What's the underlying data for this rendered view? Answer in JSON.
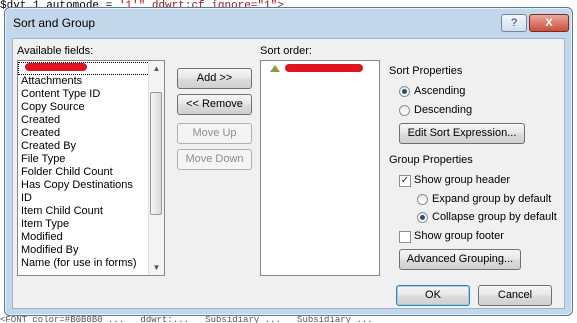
{
  "background_code": {
    "top_line_parts": [
      "$dvt_1_automode = ",
      "'1'",
      "\" ddwrt:cf_ignore=\"1\">"
    ],
    "bottom_line": "<FONT color=#B0B0B0 ...   ddwrt:...   Subsidiary ...   Subsidiary ..."
  },
  "dialog": {
    "title": "Sort and Group",
    "help_label": "?",
    "close_label": "X"
  },
  "available_fields": {
    "label": "Available fields:",
    "items": [
      "",
      "Attachments",
      "Content Type ID",
      "Copy Source",
      "Created",
      "Created",
      "Created By",
      "File Type",
      "Folder Child Count",
      "Has Copy Destinations",
      "ID",
      "Item Child Count",
      "Item Type",
      "Modified",
      "Modified By",
      "Name (for use in forms)"
    ]
  },
  "middle_buttons": {
    "add": "Add >>",
    "remove": "<< Remove",
    "move_up": "Move Up",
    "move_down": "Move Down"
  },
  "sort_order": {
    "label": "Sort order:",
    "items": [
      ""
    ]
  },
  "sort_properties": {
    "heading": "Sort Properties",
    "ascending": "Ascending",
    "descending": "Descending",
    "selected": "Ascending",
    "edit_expression": "Edit Sort Expression..."
  },
  "group_properties": {
    "heading": "Group Properties",
    "show_header": "Show group header",
    "show_header_checked": true,
    "expand_default": "Expand group by default",
    "collapse_default": "Collapse group by default",
    "selected": "Collapse group by default",
    "show_footer": "Show group footer",
    "show_footer_checked": false,
    "advanced": "Advanced Grouping..."
  },
  "footer": {
    "ok": "OK",
    "cancel": "Cancel"
  }
}
